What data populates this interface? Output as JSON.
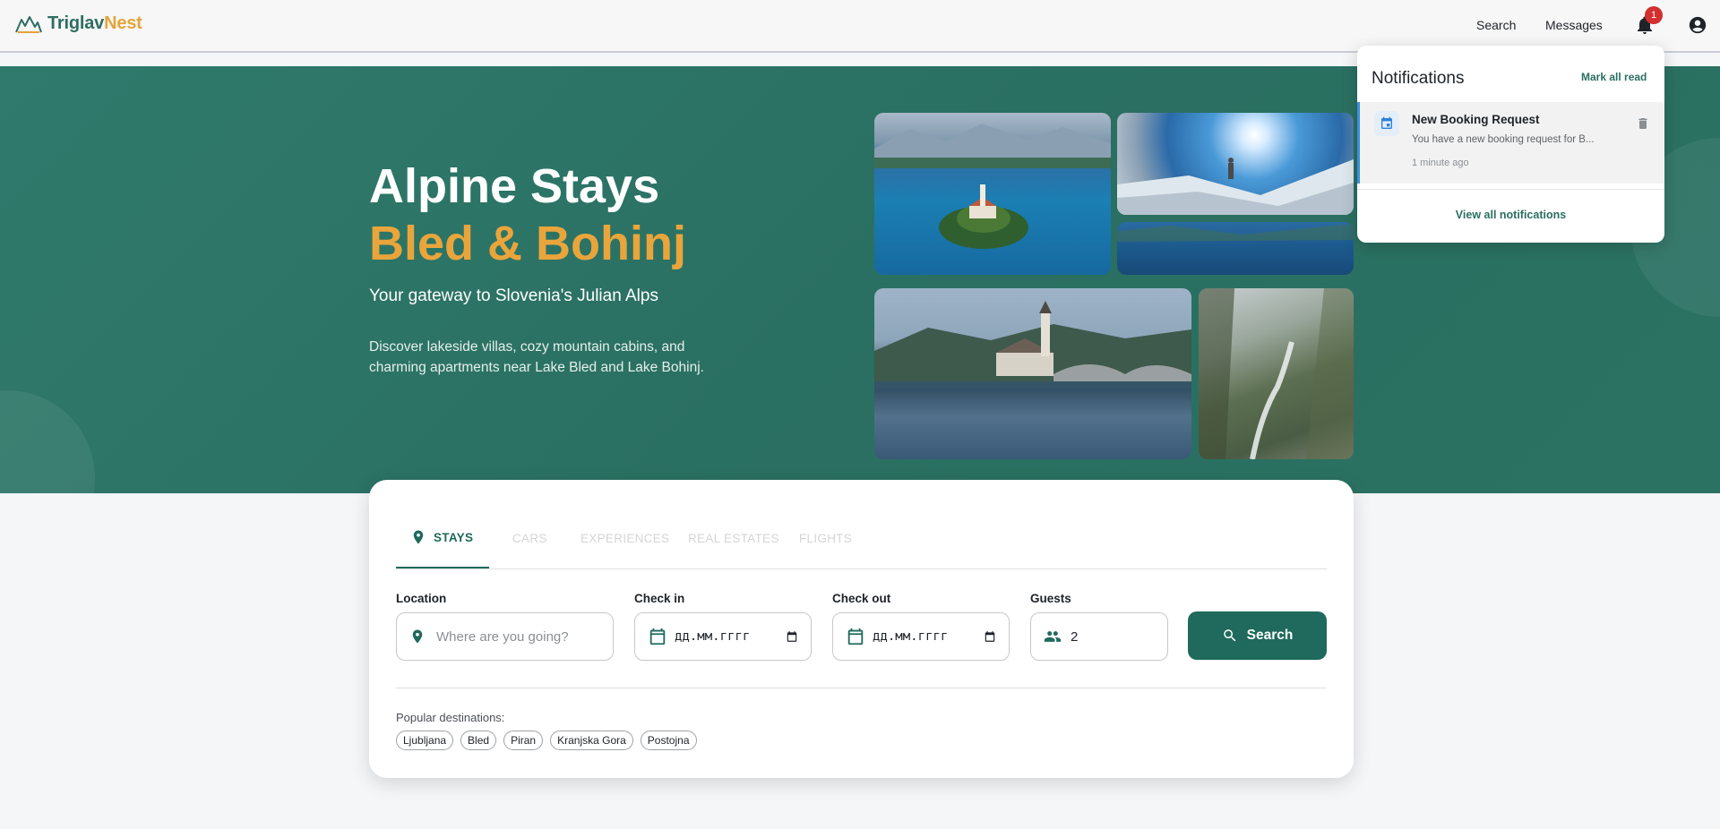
{
  "brand": {
    "name_part1": "Triglav",
    "name_part2": "Nest"
  },
  "nav": {
    "search": "Search",
    "messages": "Messages",
    "notification_count": "1"
  },
  "hero": {
    "title_line1": "Alpine Stays",
    "title_line2": "Bled & Bohinj",
    "subtitle": "Your gateway to Slovenia's Julian Alps",
    "description": "Discover lakeside villas, cozy mountain cabins, and charming apartments near Lake Bled and Lake Bohinj."
  },
  "notifications": {
    "title": "Notifications",
    "mark_all_read": "Mark all read",
    "items": [
      {
        "title": "New Booking Request",
        "text": "You have a new booking request for B...",
        "time": "1 minute ago"
      }
    ],
    "view_all": "View all notifications"
  },
  "search": {
    "tabs": [
      {
        "label": "STAYS",
        "active": true
      },
      {
        "label": "CARS",
        "active": false
      },
      {
        "label": "EXPERIENCES",
        "active": false
      },
      {
        "label": "REAL ESTATES",
        "active": false
      },
      {
        "label": "FLIGHTS",
        "active": false
      }
    ],
    "location": {
      "label": "Location",
      "placeholder": "Where are you going?"
    },
    "check_in": {
      "label": "Check in",
      "value": "дд.мм.гггг"
    },
    "check_out": {
      "label": "Check out",
      "value": "дд.мм.гггг"
    },
    "guests": {
      "label": "Guests",
      "value": "2"
    },
    "button": "Search",
    "popular_label": "Popular destinations:",
    "popular": [
      "Ljubljana",
      "Bled",
      "Piran",
      "Kranjska Gora",
      "Postojna"
    ]
  },
  "colors": {
    "primary": "#1f6a5c",
    "accent": "#e9a53b",
    "hero_bg": "#2f7a6c",
    "badge": "#d32f2f"
  }
}
